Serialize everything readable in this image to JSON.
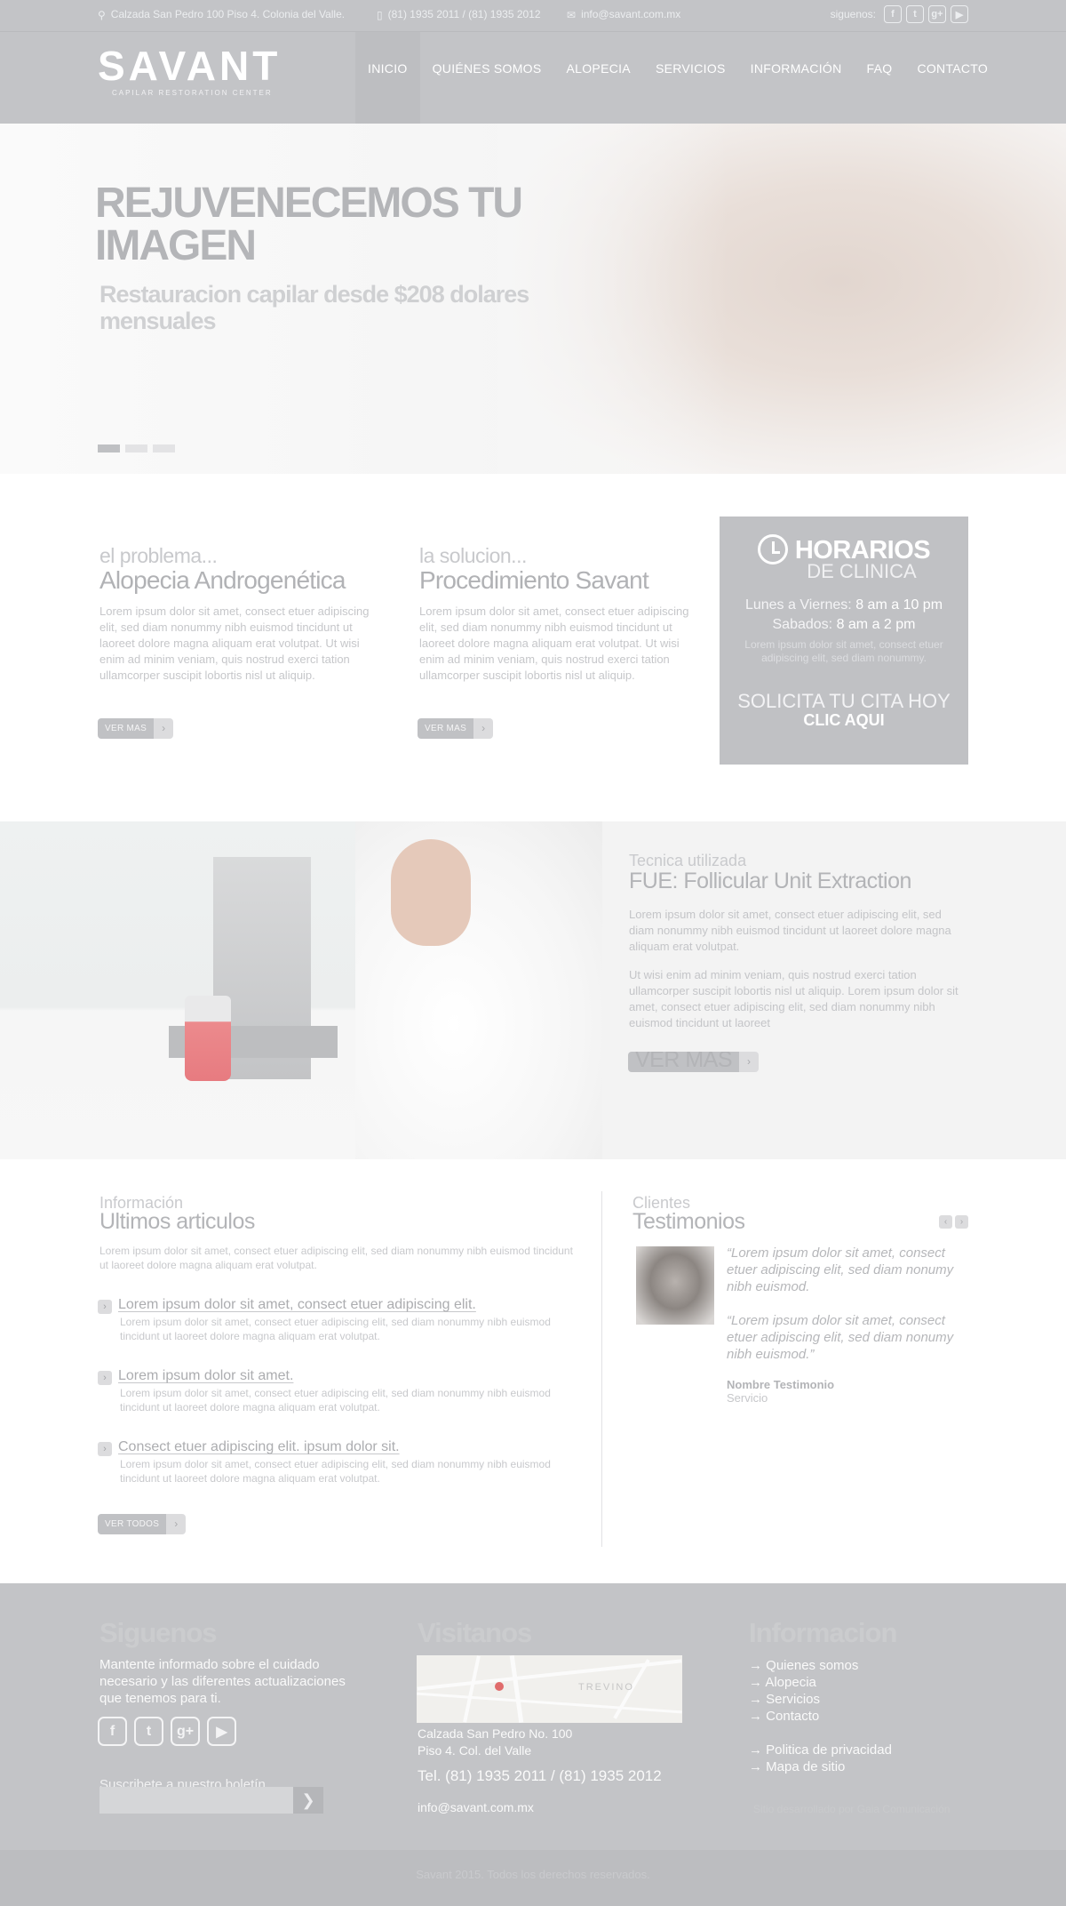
{
  "topbar": {
    "address": "Calzada San Pedro 100 Piso 4. Colonia del Valle.",
    "phones": "(81) 1935 2011 / (81) 1935 2012",
    "email": "info@savant.com.mx",
    "social_label": "siguenos:",
    "social": [
      "f",
      "t",
      "g+",
      "▶"
    ]
  },
  "header": {
    "logo": "SAVANT",
    "logo_sub": "CAPILAR RESTORATION CENTER",
    "nav": [
      "INICIO",
      "QUIÉNES SOMOS",
      "ALOPECIA",
      "SERVICIOS",
      "INFORMACIÓN",
      "FAQ",
      "CONTACTO"
    ]
  },
  "hero": {
    "title": "REJUVENECEMOS TU IMAGEN",
    "subtitle": "Restauracion capilar desde $208 dolares mensuales",
    "slides": 3,
    "active_slide": 1
  },
  "problem": {
    "kicker": "el problema...",
    "title": "Alopecia Androgenética",
    "body": "Lorem ipsum dolor sit amet, consect etuer adipiscing elit, sed diam nonummy nibh euismod tincidunt ut laoreet dolore magna aliquam erat volutpat. Ut wisi enim ad minim veniam, quis nostrud exerci tation ullamcorper suscipit lobortis nisl ut aliquip.",
    "button": "VER MAS"
  },
  "solution": {
    "kicker": "la solucion...",
    "title": "Procedimiento Savant",
    "body": "Lorem ipsum dolor sit amet, consect etuer adipiscing elit, sed diam nonummy nibh euismod tincidunt ut laoreet dolore magna aliquam erat volutpat. Ut wisi enim ad minim veniam, quis nostrud exerci tation ullamcorper suscipit lobortis nisl ut aliquip.",
    "button": "VER MAS"
  },
  "schedule": {
    "title": "HORARIOS",
    "subtitle": "DE CLINICA",
    "weekdays_label": "Lunes a Viernes:",
    "weekdays_hours": "8 am a 10 pm",
    "saturday_label": "Sabados:",
    "saturday_hours": "8 am a 2 pm",
    "note": "Lorem ipsum dolor sit amet, consect etuer adipiscing elit, sed diam nonummy.",
    "cta_line1": "SOLICITA TU CITA HOY",
    "cta_line2": "CLIC AQUI"
  },
  "technique": {
    "kicker": "Tecnica utilizada",
    "title": "FUE: Follicular Unit Extraction",
    "p1": "Lorem ipsum dolor sit amet, consect etuer adipiscing elit, sed diam nonummy nibh euismod tincidunt ut laoreet dolore magna aliquam erat volutpat.",
    "p2": "Ut wisi enim ad minim veniam, quis nostrud exerci tation ullamcorper suscipit lobortis nisl ut aliquip. Lorem ipsum dolor sit amet, consect etuer adipiscing elit, sed diam nonummy nibh euismod tincidunt ut laoreet",
    "button": "VER MAS"
  },
  "articles": {
    "kicker": "Información",
    "title": "Ultimos articulos",
    "intro": "Lorem ipsum dolor sit amet, consect etuer adipiscing elit, sed diam nonummy nibh euismod tincidunt ut laoreet dolore magna aliquam erat volutpat.",
    "items": [
      {
        "title": "Lorem ipsum dolor sit amet, consect etuer adipiscing elit.",
        "desc": "Lorem ipsum dolor sit amet, consect etuer adipiscing elit, sed diam nonummy nibh euismod tincidunt ut laoreet dolore magna aliquam erat volutpat."
      },
      {
        "title": "Lorem ipsum dolor sit amet.",
        "desc": "Lorem ipsum dolor sit amet, consect etuer adipiscing elit, sed diam nonummy nibh euismod tincidunt ut laoreet dolore magna aliquam erat volutpat."
      },
      {
        "title": "Consect etuer adipiscing elit. ipsum dolor sit.",
        "desc": "Lorem ipsum dolor sit amet, consect etuer adipiscing elit, sed diam nonummy nibh euismod tincidunt ut laoreet dolore magna aliquam erat volutpat."
      }
    ],
    "button": "VER TODOS"
  },
  "testimonials": {
    "kicker": "Clientes",
    "title": "Testimonios",
    "quote1": "“Lorem ipsum dolor sit amet, consect etuer adipiscing elit, sed diam nonumy nibh euismod.",
    "quote2": "“Lorem ipsum dolor sit amet, consect etuer adipiscing elit, sed diam nonumy nibh euismod.”",
    "name": "Nombre Testimonio",
    "service": "Servicio"
  },
  "footer": {
    "follow_title": "Siguenos",
    "follow_text": "Mantente informado sobre el cuidado necesario y las diferentes actualizaciones que tenemos para ti.",
    "social": [
      "f",
      "t",
      "g+",
      "▶"
    ],
    "newsletter_label": "Suscribete a nuestro boletín",
    "newsletter_button": "❯",
    "visit_title": "Visitanos",
    "map_label": "TREVINO",
    "address1": "Calzada San Pedro No. 100",
    "address2": "Piso 4. Col. del Valle",
    "tel": "Tel. (81) 1935 2011 / (81) 1935 2012",
    "email": "info@savant.com.mx",
    "info_title": "Informacion",
    "links1": [
      "Quienes somos",
      "Alopecia",
      "Servicios",
      "Contacto"
    ],
    "links2": [
      "Politica de privacidad",
      "Mapa de sitio"
    ],
    "credits": "Sitio desarrollado por Gaia Comunicación",
    "copyright": "Savant 2015. Todos los derechos reservados."
  }
}
